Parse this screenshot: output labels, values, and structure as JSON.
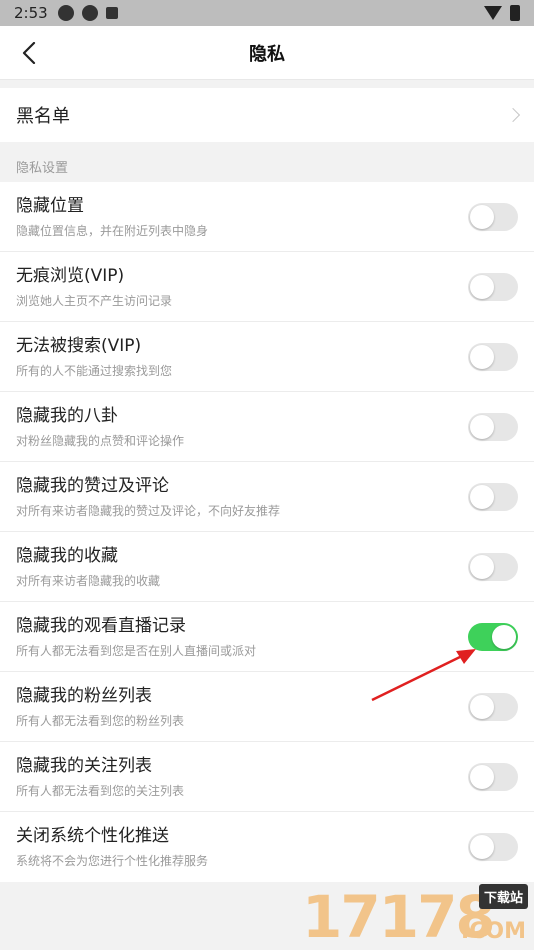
{
  "status_bar": {
    "time": "2:53"
  },
  "nav": {
    "title": "隐私"
  },
  "blacklist": {
    "label": "黑名单"
  },
  "privacy_section": {
    "header": "隐私设置"
  },
  "settings": [
    {
      "title": "隐藏位置",
      "desc": "隐藏位置信息，并在附近列表中隐身",
      "enabled": false
    },
    {
      "title": "无痕浏览(VIP)",
      "desc": "浏览她人主页不产生访问记录",
      "enabled": false
    },
    {
      "title": "无法被搜索(VIP)",
      "desc": "所有的人不能通过搜索找到您",
      "enabled": false
    },
    {
      "title": "隐藏我的八卦",
      "desc": "对粉丝隐藏我的点赞和评论操作",
      "enabled": false
    },
    {
      "title": "隐藏我的赞过及评论",
      "desc": "对所有来访者隐藏我的赞过及评论，不向好友推荐",
      "enabled": false
    },
    {
      "title": "隐藏我的收藏",
      "desc": "对所有来访者隐藏我的收藏",
      "enabled": false
    },
    {
      "title": "隐藏我的观看直播记录",
      "desc": "所有人都无法看到您是否在别人直播间或派对",
      "enabled": true
    },
    {
      "title": "隐藏我的粉丝列表",
      "desc": "所有人都无法看到您的粉丝列表",
      "enabled": false
    },
    {
      "title": "隐藏我的关注列表",
      "desc": "所有人都无法看到您的关注列表",
      "enabled": false
    },
    {
      "title": "关闭系统个性化推送",
      "desc": "系统将不会为您进行个性化推荐服务",
      "enabled": false
    }
  ],
  "watermark": {
    "number": "17178",
    "badge": "下载站",
    "suffix": ".COM"
  },
  "colors": {
    "toggle_on": "#3ed15a",
    "toggle_off": "#e6e6e6",
    "annotation_arrow": "#e02020"
  }
}
